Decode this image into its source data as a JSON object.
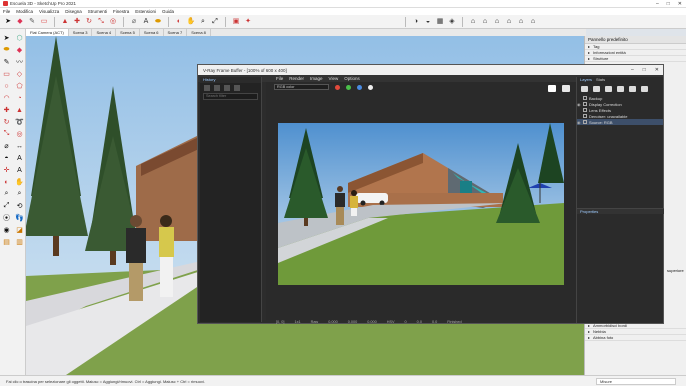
{
  "app": {
    "title": "Escuela 3D - SketchUp Pro 2021",
    "menus": [
      "File",
      "Modifica",
      "Visualizza",
      "Disegna",
      "Strumenti",
      "Finestra",
      "Estensioni",
      "Guida"
    ]
  },
  "scenes": [
    "Flat Camera (ACT)",
    "Scena 3",
    "Scena 4",
    "Scena 5",
    "Scena 6",
    "Scena 7",
    "Scena 8"
  ],
  "tray": {
    "title": "Pannello predefinito",
    "top_items": [
      "Tag",
      "Informazioni entità",
      "Strutture"
    ],
    "bottom_items": [
      "Ammorbidisci bordi",
      "Nebbia",
      "Abbina foto"
    ],
    "side_label": "superiore"
  },
  "status": {
    "hint": "Fai clic o trascina per selezionare gli oggetti. Maiusc = Aggiungi/rimuovi. Ctrl = Aggiungi. Maiusc + Ctrl = rimuovi.",
    "measure_label": "Misure"
  },
  "vfb": {
    "title": "V-Ray Frame Buffer - [100% of 600 x 400]",
    "menus": [
      "File",
      "Render",
      "Image",
      "View",
      "Options"
    ],
    "history_label": "History",
    "search_placeholder": "Search filter",
    "channel": "RGB color",
    "layers_tabs": [
      "Layers",
      "Stats"
    ],
    "layers": [
      "Display Correction",
      "Lens Effects",
      "Denoiser: unavailable",
      "Source: RGB"
    ],
    "layers_top": "Backup",
    "properties_label": "Properties",
    "status": [
      "[0, 0]",
      "1x1",
      "Raw",
      "0.000",
      "0.000",
      "0.000",
      "HSV",
      "0",
      "0.0",
      "0.0",
      "Finished"
    ]
  }
}
